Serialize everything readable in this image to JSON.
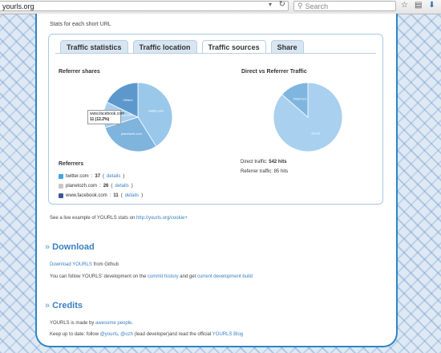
{
  "browser": {
    "url": "yourls.org",
    "search_placeholder": "Search"
  },
  "stats": {
    "caption": "Stats for each short URL",
    "tabs": [
      "Traffic statistics",
      "Traffic location",
      "Traffic sources",
      "Share"
    ],
    "active_tab": "Traffic sources",
    "referrer_shares_title": "Referrer shares",
    "direct_vs_referrer_title": "Direct vs Referrer Traffic",
    "tooltip_site": "www.facebook.com",
    "tooltip_value": "11 (12.2%)",
    "referrer_pie": {
      "slices": [
        {
          "label": "twitter.com",
          "value": 37,
          "color": "#9ac8ea"
        },
        {
          "label": "planetozh.com",
          "value": 26,
          "color": "#7fb4dd"
        },
        {
          "label": "www.facebook.com",
          "value": 11,
          "color": "#a9cfee"
        },
        {
          "label": "Others",
          "value": 16,
          "color": "#5d98cc"
        }
      ]
    },
    "direct_pie": {
      "slices": [
        {
          "label": "Direct",
          "value": 542,
          "color": "#a9d0ef"
        },
        {
          "label": "Referrers",
          "value": 85,
          "color": "#7fb6df"
        }
      ]
    },
    "referrers_title": "Referrers",
    "referrers": [
      {
        "icon": "twitter-icon",
        "color": "#3fa6e0",
        "site": "twitter.com",
        "count": "37",
        "details": "details"
      },
      {
        "icon": "planetozh-icon",
        "color": "#c7c7c7",
        "site": "planetozh.com",
        "count": "26",
        "details": "details"
      },
      {
        "icon": "facebook-icon",
        "color": "#3b5998",
        "site": "www.facebook.com",
        "count": "11",
        "details": "details"
      }
    ],
    "direct_label": "Direct traffic:",
    "direct_value": "542 hits",
    "referrer_label": "Referrer traffic:",
    "referrer_value": "85 hits"
  },
  "live": {
    "text": "See a live example of YOURLS stats on",
    "link": "http://yourls.org/cookie+"
  },
  "download": {
    "heading": "Download",
    "line1_link": "Download YOURLS",
    "line1_rest": "from Github",
    "line2_a": "You can follow YOURLS' development on the",
    "line2_link1": "commit history",
    "line2_b": "and get",
    "line2_link2": "current development build"
  },
  "credits": {
    "heading": "Credits",
    "line1_a": "YOURLS is made by",
    "line1_link": "awesome people",
    "line1_b": ".",
    "line2_a": "Keep up to date: follow",
    "line2_link1": "@yourls",
    "line2_sep": ",",
    "line2_link2": "@ozh",
    "line2_b": "(lead developer)and read the official",
    "line2_link3": "YOURLS Blog"
  }
}
